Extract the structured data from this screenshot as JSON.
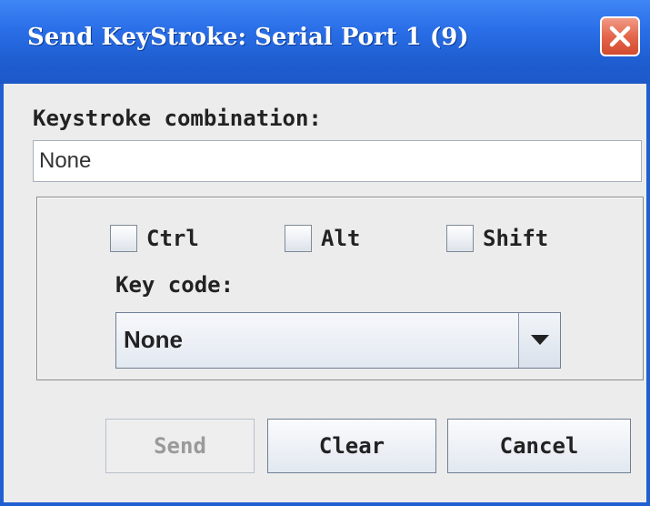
{
  "window": {
    "title": "Send KeyStroke: Serial Port 1 (9)",
    "close_icon": "close-x-icon",
    "accent_color": "#1f5fd2",
    "close_color": "#e3664c"
  },
  "keystroke": {
    "label": "Keystroke combination:",
    "value": "None"
  },
  "modifiers": {
    "ctrl": {
      "label": "Ctrl",
      "checked": false
    },
    "alt": {
      "label": "Alt",
      "checked": false
    },
    "shift": {
      "label": "Shift",
      "checked": false
    }
  },
  "key_code": {
    "label": "Key code:",
    "selected": "None",
    "dropdown_icon": "chevron-down-icon"
  },
  "buttons": {
    "send": {
      "label": "Send",
      "enabled": false
    },
    "clear": {
      "label": "Clear",
      "enabled": true
    },
    "cancel": {
      "label": "Cancel",
      "enabled": true
    }
  }
}
